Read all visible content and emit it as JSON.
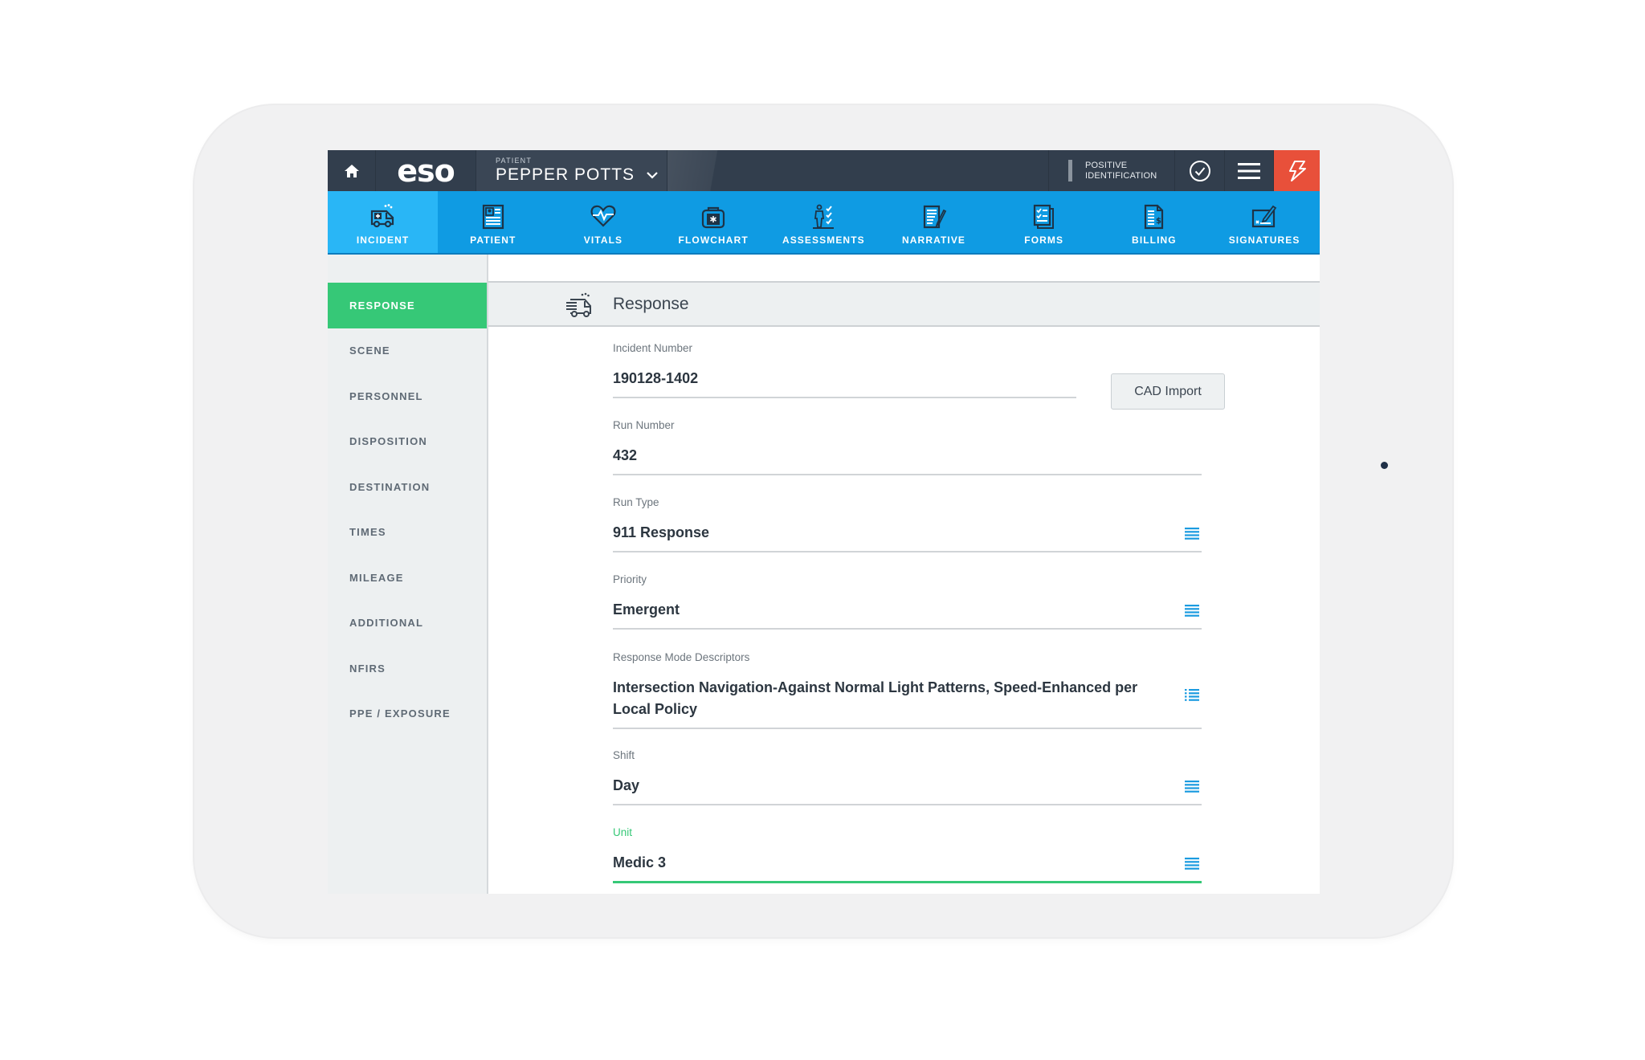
{
  "header": {
    "logo": "eso",
    "patient_label": "PATIENT",
    "patient_name": "PEPPER POTTS",
    "positive_id_line1": "POSITIVE",
    "positive_id_line2": "IDENTIFICATION"
  },
  "nav": {
    "tabs": [
      {
        "label": "INCIDENT",
        "icon": "ambulance-icon",
        "active": true
      },
      {
        "label": "PATIENT",
        "icon": "patient-card-icon",
        "active": false
      },
      {
        "label": "VITALS",
        "icon": "heart-pulse-icon",
        "active": false
      },
      {
        "label": "FLOWCHART",
        "icon": "medical-bag-icon",
        "active": false
      },
      {
        "label": "ASSESSMENTS",
        "icon": "body-checklist-icon",
        "active": false
      },
      {
        "label": "NARRATIVE",
        "icon": "document-pen-icon",
        "active": false
      },
      {
        "label": "FORMS",
        "icon": "forms-checklist-icon",
        "active": false
      },
      {
        "label": "BILLING",
        "icon": "billing-document-icon",
        "active": false
      },
      {
        "label": "SIGNATURES",
        "icon": "signature-icon",
        "active": false
      }
    ]
  },
  "sidebar": {
    "items": [
      {
        "label": "RESPONSE",
        "active": true
      },
      {
        "label": "SCENE",
        "active": false
      },
      {
        "label": "PERSONNEL",
        "active": false
      },
      {
        "label": "DISPOSITION",
        "active": false
      },
      {
        "label": "DESTINATION",
        "active": false
      },
      {
        "label": "TIMES",
        "active": false
      },
      {
        "label": "MILEAGE",
        "active": false
      },
      {
        "label": "ADDITIONAL",
        "active": false
      },
      {
        "label": "NFIRS",
        "active": false
      },
      {
        "label": "PPE / EXPOSURE",
        "active": false
      }
    ]
  },
  "section": {
    "title": "Response",
    "cad_import_label": "CAD Import",
    "fields": [
      {
        "label": "Incident Number",
        "value": "190128-1402",
        "type": "text"
      },
      {
        "label": "Run Number",
        "value": "432",
        "type": "text"
      },
      {
        "label": "Run Type",
        "value": "911 Response",
        "type": "select"
      },
      {
        "label": "Priority",
        "value": "Emergent",
        "type": "select"
      },
      {
        "label": "Response Mode Descriptors",
        "value": "Intersection Navigation-Against Normal Light Patterns, Speed-Enhanced per Local Policy",
        "type": "multiselect"
      },
      {
        "label": "Shift",
        "value": "Day",
        "type": "select"
      },
      {
        "label": "Unit",
        "value": "Medic 3",
        "type": "select",
        "focused": true
      }
    ]
  },
  "colors": {
    "header_dark": "#323e4d",
    "nav_blue": "#0f9be3",
    "nav_active": "#29b6f6",
    "accent_green": "#36c877",
    "alert_red": "#e8503a",
    "list_icon_blue": "#1a9be0"
  }
}
